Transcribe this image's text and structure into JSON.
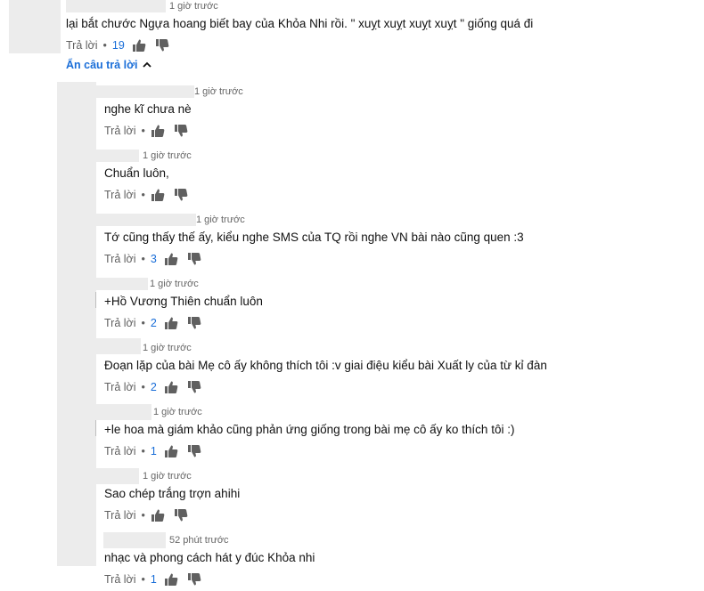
{
  "main_comment": {
    "time": "1 giờ trước",
    "text": "lại bắt chước Ngựa hoang biết bay của Khỏa Nhi rồi. \" xuỵt xuỵt xuỵt xuỵt \" giống quá đi",
    "reply_label": "Trả lời",
    "likes": "19"
  },
  "hide_replies_label": "Ẩn câu trả lời",
  "icons": {
    "like": "thumbs-up-icon",
    "dislike": "thumbs-down-icon",
    "collapse": "chevron-up-icon"
  },
  "colors": {
    "accent": "#1a6ed8",
    "muted": "#606060",
    "text": "#111111"
  },
  "replies": [
    {
      "time": "1 giờ trước",
      "text": "nghe kĩ chưa nè",
      "reply_label": "Trả lời",
      "likes": ""
    },
    {
      "time": "1 giờ trước",
      "text": "Chuẩn luôn,",
      "reply_label": "Trả lời",
      "likes": ""
    },
    {
      "time": "1 giờ trước",
      "text": "Tớ cũng thấy thế ấy, kiểu nghe SMS của TQ rồi nghe VN bài nào cũng quen :3",
      "reply_label": "Trả lời",
      "likes": "3"
    },
    {
      "time": "1 giờ trước",
      "text": "+Hồ Vương Thiên chuẩn luôn",
      "reply_label": "Trả lời",
      "likes": "2"
    },
    {
      "time": "1 giờ trước",
      "text": "Đoạn lặp của bài Mẹ cô ấy không thích tôi :v giai điệu kiểu bài Xuất ly của từ kỉ đàn",
      "reply_label": "Trả lời",
      "likes": "2"
    },
    {
      "time": "1 giờ trước",
      "text": "+le hoa mà giám khảo cũng phản ứng giống trong bài mẹ cô ấy ko thích tôi :)",
      "reply_label": "Trả lời",
      "likes": "1"
    },
    {
      "time": "1 giờ trước",
      "text": "Sao chép trắng trợn ahihi",
      "reply_label": "Trả lời",
      "likes": ""
    },
    {
      "time": "52 phút trước",
      "text": "nhạc và phong cách hát y đúc Khỏa nhi",
      "reply_label": "Trả lời",
      "likes": "1"
    }
  ]
}
